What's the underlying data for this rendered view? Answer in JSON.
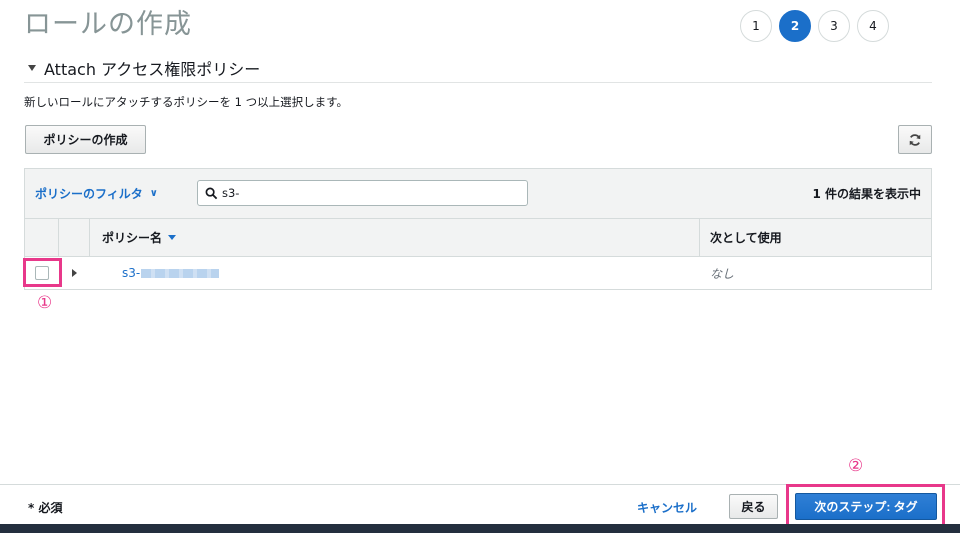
{
  "page": {
    "title": "ロールの作成"
  },
  "steps": [
    {
      "label": "1",
      "active": false
    },
    {
      "label": "2",
      "active": true
    },
    {
      "label": "3",
      "active": false
    },
    {
      "label": "4",
      "active": false
    }
  ],
  "section": {
    "title": "Attach アクセス権限ポリシー"
  },
  "description": "新しいロールにアタッチするポリシーを 1 つ以上選択します。",
  "toolbar": {
    "create_policy_label": "ポリシーの作成",
    "refresh_icon": "refresh-icon"
  },
  "filter": {
    "label": "ポリシーのフィルタ",
    "search_value": "s3-",
    "result_count": "1 件の結果を表示中"
  },
  "table": {
    "columns": {
      "name": "ポリシー名",
      "usage": "次として使用"
    },
    "rows": [
      {
        "name": "s3-",
        "usage": "なし"
      }
    ]
  },
  "annotations": {
    "one": "①",
    "two": "②"
  },
  "footer": {
    "required_label": "* 必須",
    "cancel_label": "キャンセル",
    "back_label": "戻る",
    "next_label": "次のステップ: タグ"
  },
  "colors": {
    "accent": "#1b6fc9",
    "annotation": "#e8388a",
    "bottom_bar": "#232f3e"
  }
}
